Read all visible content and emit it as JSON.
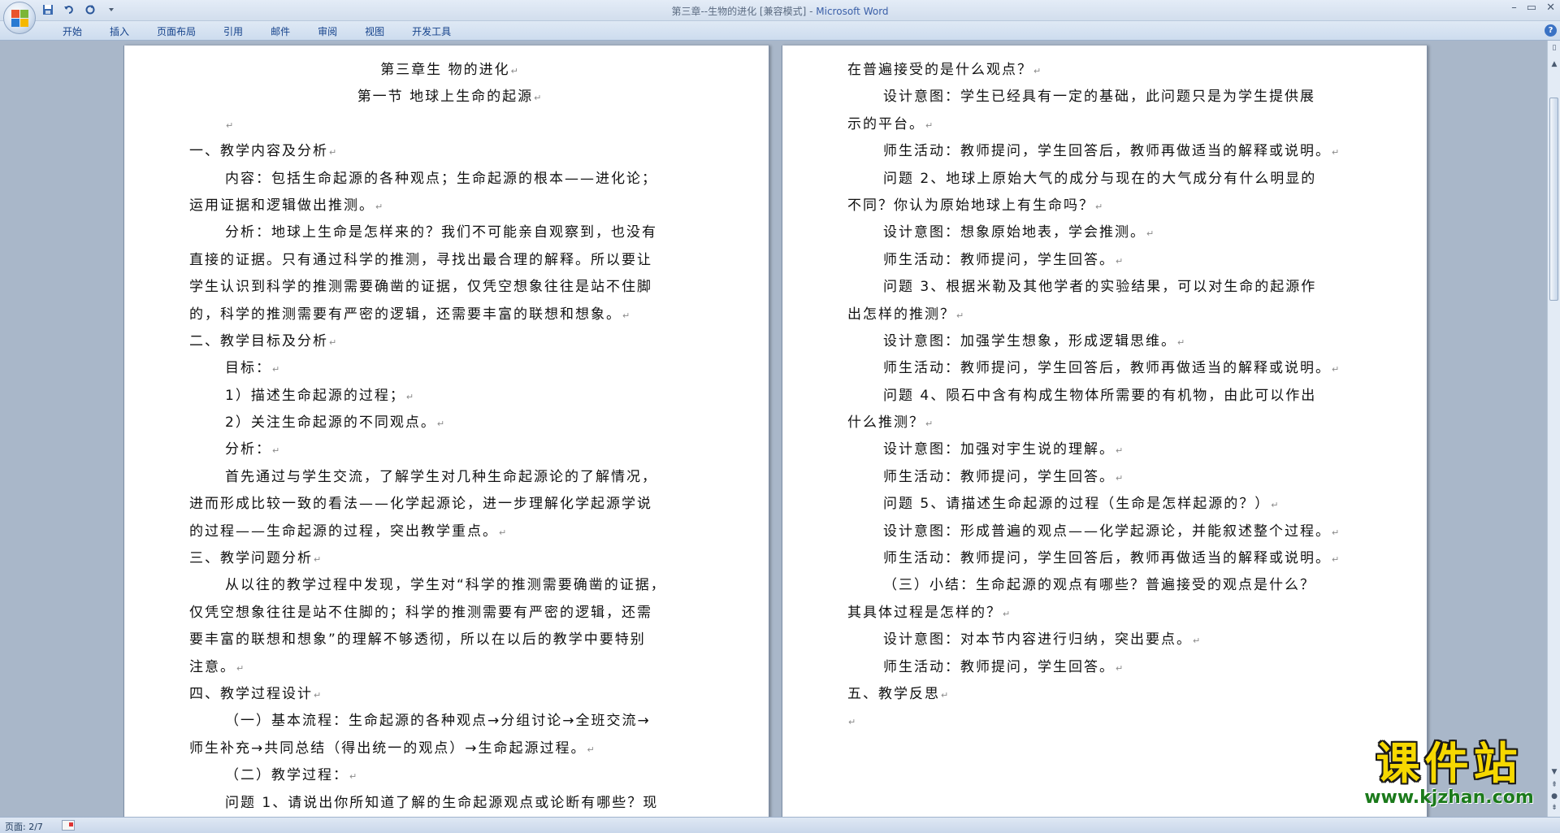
{
  "window": {
    "title": "第三章--生物的进化 [兼容模式]",
    "separator": " - ",
    "app": "Microsoft Word"
  },
  "ribbon": {
    "tabs": [
      "开始",
      "插入",
      "页面布局",
      "引用",
      "邮件",
      "审阅",
      "视图",
      "开发工具"
    ]
  },
  "icons": {
    "qat": [
      "save-icon",
      "undo-icon",
      "redo-icon",
      "customize-qat-icon"
    ]
  },
  "colors": {
    "ribbon_text": "#15428b",
    "app_title": "#3a5fa8",
    "watermark_yellow": "#f6d800",
    "watermark_green": "#1b7a1b"
  },
  "document": {
    "left_page": [
      {
        "text": "第三章生 物的进化",
        "style": "center"
      },
      {
        "text": "第一节  地球上生命的起源",
        "style": "center"
      },
      {
        "text": "",
        "style": "ind"
      },
      {
        "text": "一、教学内容及分析",
        "style": "plain"
      },
      {
        "text": "内容：包括生命起源的各种观点；生命起源的根本——进化论；",
        "style": "ind",
        "nomark": true
      },
      {
        "text": "运用证据和逻辑做出推测。",
        "style": "plain"
      },
      {
        "text": "分析：地球上生命是怎样来的？我们不可能亲自观察到，也没有",
        "style": "ind",
        "nomark": true
      },
      {
        "text": "直接的证据。只有通过科学的推测，寻找出最合理的解释。所以要让",
        "style": "plain",
        "nomark": true
      },
      {
        "text": "学生认识到科学的推测需要确凿的证据，仅凭空想象往往是站不住脚",
        "style": "plain",
        "nomark": true
      },
      {
        "text": "的，科学的推测需要有严密的逻辑，还需要丰富的联想和想象。",
        "style": "plain"
      },
      {
        "text": "二、教学目标及分析",
        "style": "plain"
      },
      {
        "text": "目标：",
        "style": "ind"
      },
      {
        "text": "1）描述生命起源的过程；",
        "style": "ind"
      },
      {
        "text": "2）关注生命起源的不同观点。",
        "style": "ind"
      },
      {
        "text": "分析：",
        "style": "ind"
      },
      {
        "text": "首先通过与学生交流，了解学生对几种生命起源论的了解情况，",
        "style": "ind",
        "nomark": true
      },
      {
        "text": "进而形成比较一致的看法——化学起源论，进一步理解化学起源学说",
        "style": "plain",
        "nomark": true
      },
      {
        "text": "的过程——生命起源的过程，突出教学重点。",
        "style": "plain"
      },
      {
        "text": "三、教学问题分析",
        "style": "plain"
      },
      {
        "text": "从以往的教学过程中发现，学生对“科学的推测需要确凿的证据，",
        "style": "ind",
        "nomark": true
      },
      {
        "text": "仅凭空想象往往是站不住脚的；科学的推测需要有严密的逻辑，还需",
        "style": "plain",
        "nomark": true
      },
      {
        "text": "要丰富的联想和想象”的理解不够透彻，所以在以后的教学中要特别",
        "style": "plain",
        "nomark": true
      },
      {
        "text": "注意。",
        "style": "plain"
      },
      {
        "text": "四、教学过程设计",
        "style": "plain"
      },
      {
        "text": "（一）基本流程：生命起源的各种观点→分组讨论→全班交流→",
        "style": "ind",
        "nomark": true
      },
      {
        "text": "师生补充→共同总结（得出统一的观点）→生命起源过程。",
        "style": "plain"
      },
      {
        "text": "（二）教学过程：",
        "style": "ind"
      },
      {
        "text": "问题 1、请说出你所知道了解的生命起源观点或论断有哪些？现",
        "style": "ind",
        "nomark": true
      }
    ],
    "right_page": [
      {
        "text": "在普遍接受的是什么观点？",
        "style": "plain"
      },
      {
        "text": "设计意图：学生已经具有一定的基础，此问题只是为学生提供展",
        "style": "ind",
        "nomark": true
      },
      {
        "text": "示的平台。",
        "style": "plain"
      },
      {
        "text": "师生活动：教师提问，学生回答后，教师再做适当的解释或说明。",
        "style": "ind"
      },
      {
        "text": "问题 2、地球上原始大气的成分与现在的大气成分有什么明显的",
        "style": "ind",
        "nomark": true
      },
      {
        "text": "不同？你认为原始地球上有生命吗？",
        "style": "plain"
      },
      {
        "text": "设计意图：想象原始地表，学会推测。",
        "style": "ind"
      },
      {
        "text": "师生活动：教师提问，学生回答。",
        "style": "ind"
      },
      {
        "text": "问题 3、根据米勒及其他学者的实验结果，可以对生命的起源作",
        "style": "ind",
        "nomark": true
      },
      {
        "text": "出怎样的推测？",
        "style": "plain"
      },
      {
        "text": "设计意图：加强学生想象，形成逻辑思维。",
        "style": "ind"
      },
      {
        "text": "师生活动：教师提问，学生回答后，教师再做适当的解释或说明。",
        "style": "ind"
      },
      {
        "text": "问题 4、陨石中含有构成生物体所需要的有机物，由此可以作出",
        "style": "ind",
        "nomark": true
      },
      {
        "text": "什么推测？",
        "style": "plain"
      },
      {
        "text": "设计意图：加强对宇生说的理解。",
        "style": "ind"
      },
      {
        "text": "师生活动：教师提问，学生回答。",
        "style": "ind"
      },
      {
        "text": "问题 5、请描述生命起源的过程（生命是怎样起源的？）",
        "style": "ind"
      },
      {
        "text": "设计意图：形成普遍的观点——化学起源论，并能叙述整个过程。",
        "style": "ind"
      },
      {
        "text": "师生活动：教师提问，学生回答后，教师再做适当的解释或说明。",
        "style": "ind"
      },
      {
        "text": "（三）小结：生命起源的观点有哪些？普遍接受的观点是什么？",
        "style": "ind",
        "nomark": true
      },
      {
        "text": "其具体过程是怎样的？",
        "style": "plain"
      },
      {
        "text": "设计意图：对本节内容进行归纳，突出要点。",
        "style": "ind"
      },
      {
        "text": "师生活动：教师提问，学生回答。",
        "style": "ind"
      },
      {
        "text": "五、教学反思",
        "style": "plain"
      },
      {
        "text": "",
        "style": "plain"
      }
    ],
    "paragraph_mark": "↵"
  },
  "statusbar": {
    "page_info": "页面: 2/7"
  },
  "watermark": {
    "title": "课件站",
    "url": "www.kjzhan.com"
  }
}
